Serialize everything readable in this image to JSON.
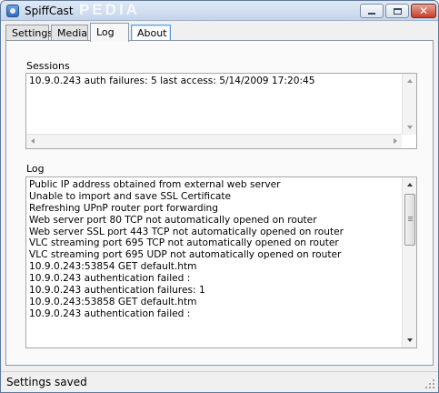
{
  "window": {
    "title": "SpiffCast",
    "watermark": "PEDIA",
    "controls": {
      "minimize": "minimize-icon",
      "maximize": "maximize-icon",
      "close": "close-icon"
    }
  },
  "tabs": [
    {
      "label": "Settings"
    },
    {
      "label": "Media"
    },
    {
      "label": "Log",
      "selected": true
    },
    {
      "label": "About",
      "hover": true
    }
  ],
  "sessions": {
    "label": "Sessions",
    "items": [
      "10.9.0.243  auth failures: 5  last access: 5/14/2009 17:20:45"
    ]
  },
  "log": {
    "label": "Log",
    "lines": [
      "Public IP address obtained from external web server",
      "Unable to import and save SSL Certificate",
      "Refreshing UPnP router port forwarding",
      "Web server port 80 TCP not automatically opened on router",
      "Web server SSL port 443 TCP not automatically opened on router",
      "VLC streaming port 695 TCP not automatically opened on router",
      "VLC streaming port 695 UDP not automatically opened on router",
      "10.9.0.243:53854 GET default.htm",
      "10.9.0.243 authentication failed :",
      "10.9.0.243 authentication failures: 1",
      "10.9.0.243:53858 GET default.htm",
      "10.9.0.243 authentication failed :"
    ]
  },
  "status": {
    "text": "Settings saved"
  },
  "colors": {
    "titlebar": "#c4d5ea",
    "close_button": "#c7402a",
    "accent_tab": "#5e9ad6"
  }
}
